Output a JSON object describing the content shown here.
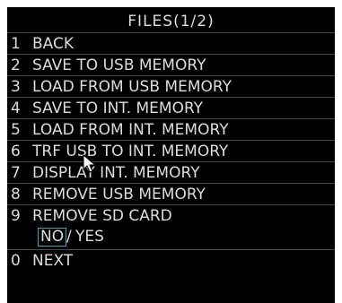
{
  "header": {
    "title": "FILES(1/2)"
  },
  "menu": {
    "items": [
      {
        "num": "1",
        "label": "BACK"
      },
      {
        "num": "2",
        "label": "SAVE TO USB MEMORY"
      },
      {
        "num": "3",
        "label": "LOAD FROM USB MEMORY"
      },
      {
        "num": "4",
        "label": "SAVE TO INT. MEMORY"
      },
      {
        "num": "5",
        "label": "LOAD FROM INT. MEMORY"
      },
      {
        "num": "6",
        "label": "TRF USB TO INT. MEMORY"
      },
      {
        "num": "7",
        "label": "DISPLAY INT. MEMORY"
      },
      {
        "num": "8",
        "label": "REMOVE USB MEMORY"
      },
      {
        "num": "9",
        "label": "REMOVE SD CARD"
      }
    ],
    "confirm": {
      "selected": "NO",
      "separator": "/",
      "other": "YES"
    },
    "next": {
      "num": "0",
      "label": "NEXT"
    }
  },
  "colors": {
    "background": "#000000",
    "text": "#dcdcdc",
    "divider": "#4a4a4a",
    "selection_border": "#24a9b6"
  },
  "icons": {
    "pointer": "mouse-pointer-icon"
  }
}
